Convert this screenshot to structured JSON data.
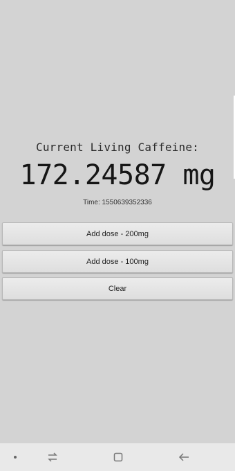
{
  "main": {
    "heading": "Current Living Caffeine:",
    "amount": "172.24587 mg",
    "time_label": "Time: 1550639352336"
  },
  "buttons": {
    "add_200": "Add dose - 200mg",
    "add_100": "Add dose - 100mg",
    "clear": "Clear"
  },
  "navbar": {
    "icons": [
      "dot-icon",
      "recents-icon",
      "home-icon",
      "back-icon"
    ]
  }
}
